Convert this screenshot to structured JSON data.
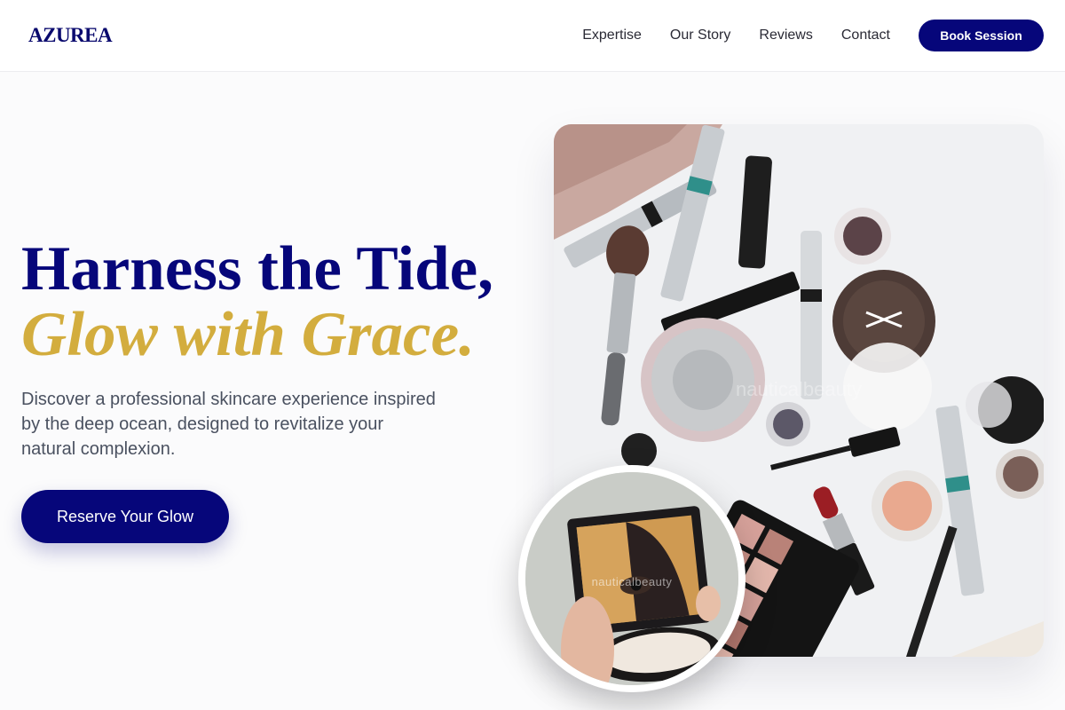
{
  "brand": {
    "logo": "AZUREA"
  },
  "nav": {
    "links": [
      "Expertise",
      "Our Story",
      "Reviews",
      "Contact"
    ],
    "cta_label": "Book Session"
  },
  "hero": {
    "headline_line1": "Harness the Tide,",
    "headline_line2": "Glow with Grace.",
    "description": "Discover a professional skincare experience inspired by the deep ocean, designed to revitalize your natural complexion.",
    "cta_label": "Reserve Your Glow",
    "main_image_alt": "Flat lay of makeup products: brushes, mascara tubes, compact powders, lipstick and eyeshadow palette",
    "main_image_watermark": "nauticalbeauty",
    "circle_image_alt": "Woman looking into a compact mirror",
    "circle_image_watermark": "nauticalbeauty"
  },
  "colors": {
    "navy": "#06067a",
    "gold": "#d3ad3e",
    "text_muted": "#4a5160",
    "background": "#fbfbfc"
  },
  "icons": {
    "main_image": "makeup-flatlay-photo",
    "circle_image": "compact-mirror-photo"
  }
}
